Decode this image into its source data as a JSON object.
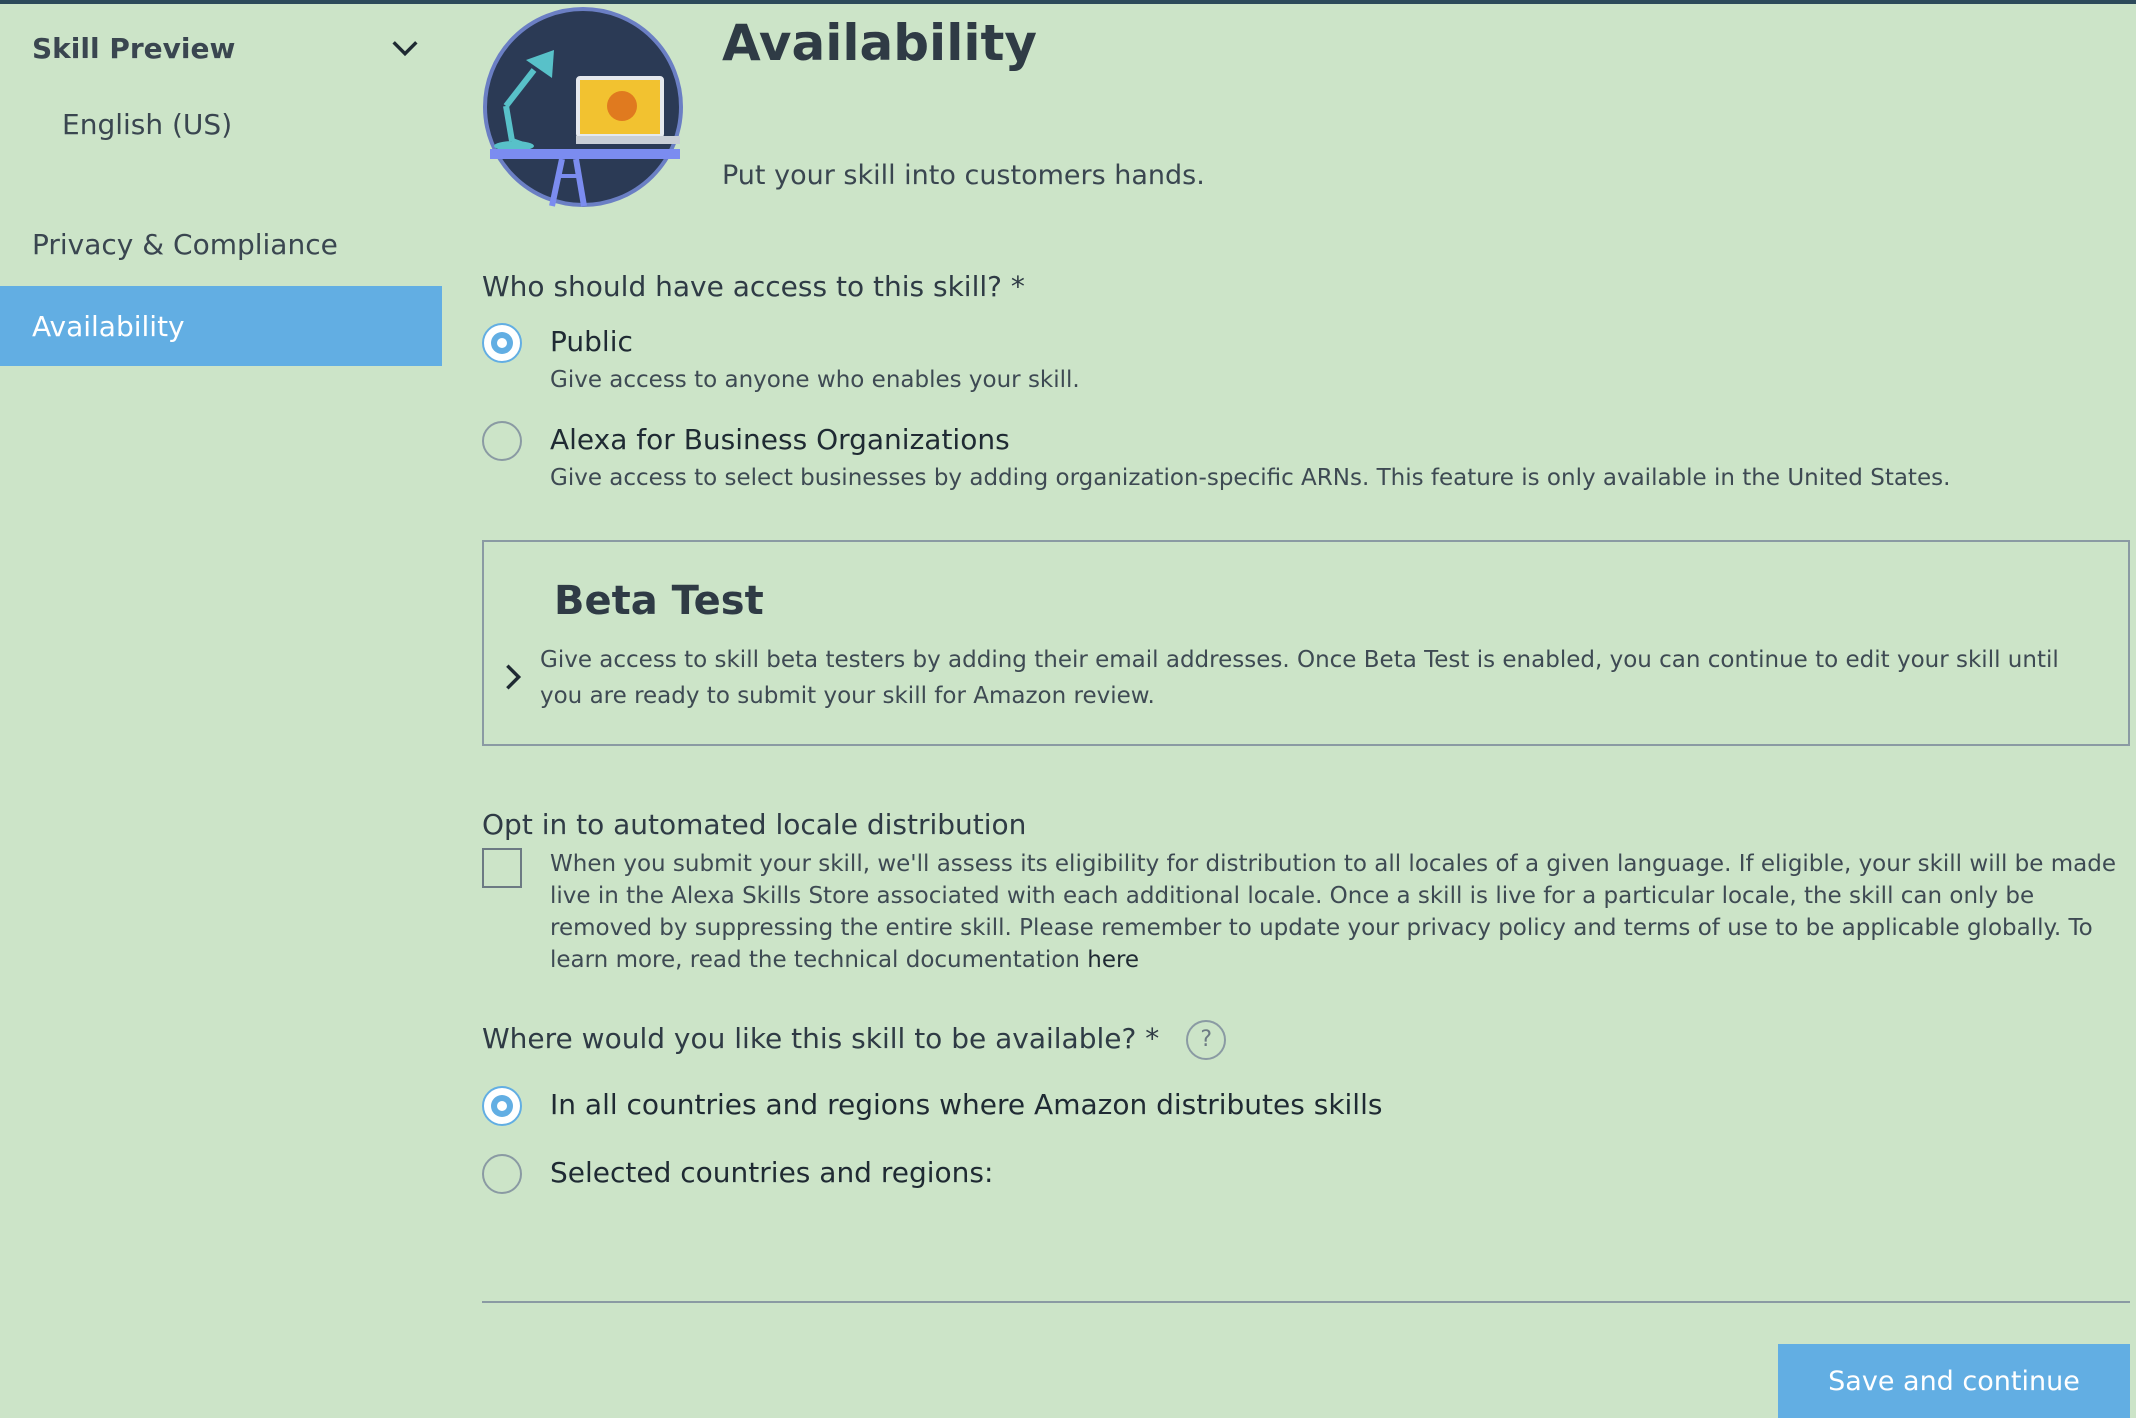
{
  "sidebar": {
    "section_label": "Skill Preview",
    "section_sub_item": "English (US)",
    "privacy_label": "Privacy & Compliance",
    "active_label": "Availability"
  },
  "header": {
    "title": "Availability",
    "subtitle": "Put your skill into customers hands."
  },
  "access": {
    "question": "Who should have access to this skill? *",
    "options": [
      {
        "label": "Public",
        "description": "Give access to anyone who enables your skill.",
        "selected": true
      },
      {
        "label": "Alexa for Business Organizations",
        "description": "Give access to select businesses by adding organization-specific ARNs. This feature is only available in the United States.",
        "selected": false
      }
    ]
  },
  "beta": {
    "title": "Beta Test",
    "description": "Give access to skill beta testers by adding their email addresses. Once Beta Test is enabled, you can continue to edit your skill until you are ready to submit your skill for Amazon review."
  },
  "locale": {
    "label": "Opt in to automated locale distribution",
    "description": "When you submit your skill, we'll assess its eligibility for distribution to all locales of a given language. If eligible, your skill will be made live in the Alexa Skills Store associated with each additional locale. Once a skill is live for a particular locale, the skill can only be removed by suppressing the entire skill. Please remember to update your privacy policy and terms of use to be applicable globally. To learn more, read the technical documentation",
    "link_text": "here",
    "checked": false
  },
  "regions": {
    "question": "Where would you like this skill to be available?  *",
    "help_glyph": "?",
    "options": [
      {
        "label": "In all countries and regions where Amazon distributes skills",
        "selected": true
      },
      {
        "label": "Selected countries and regions:",
        "selected": false
      }
    ]
  },
  "footer": {
    "save_label": "Save and continue"
  },
  "colors": {
    "background": "#cce4c8",
    "accent": "#62aee3",
    "text": "#2f3b45"
  }
}
